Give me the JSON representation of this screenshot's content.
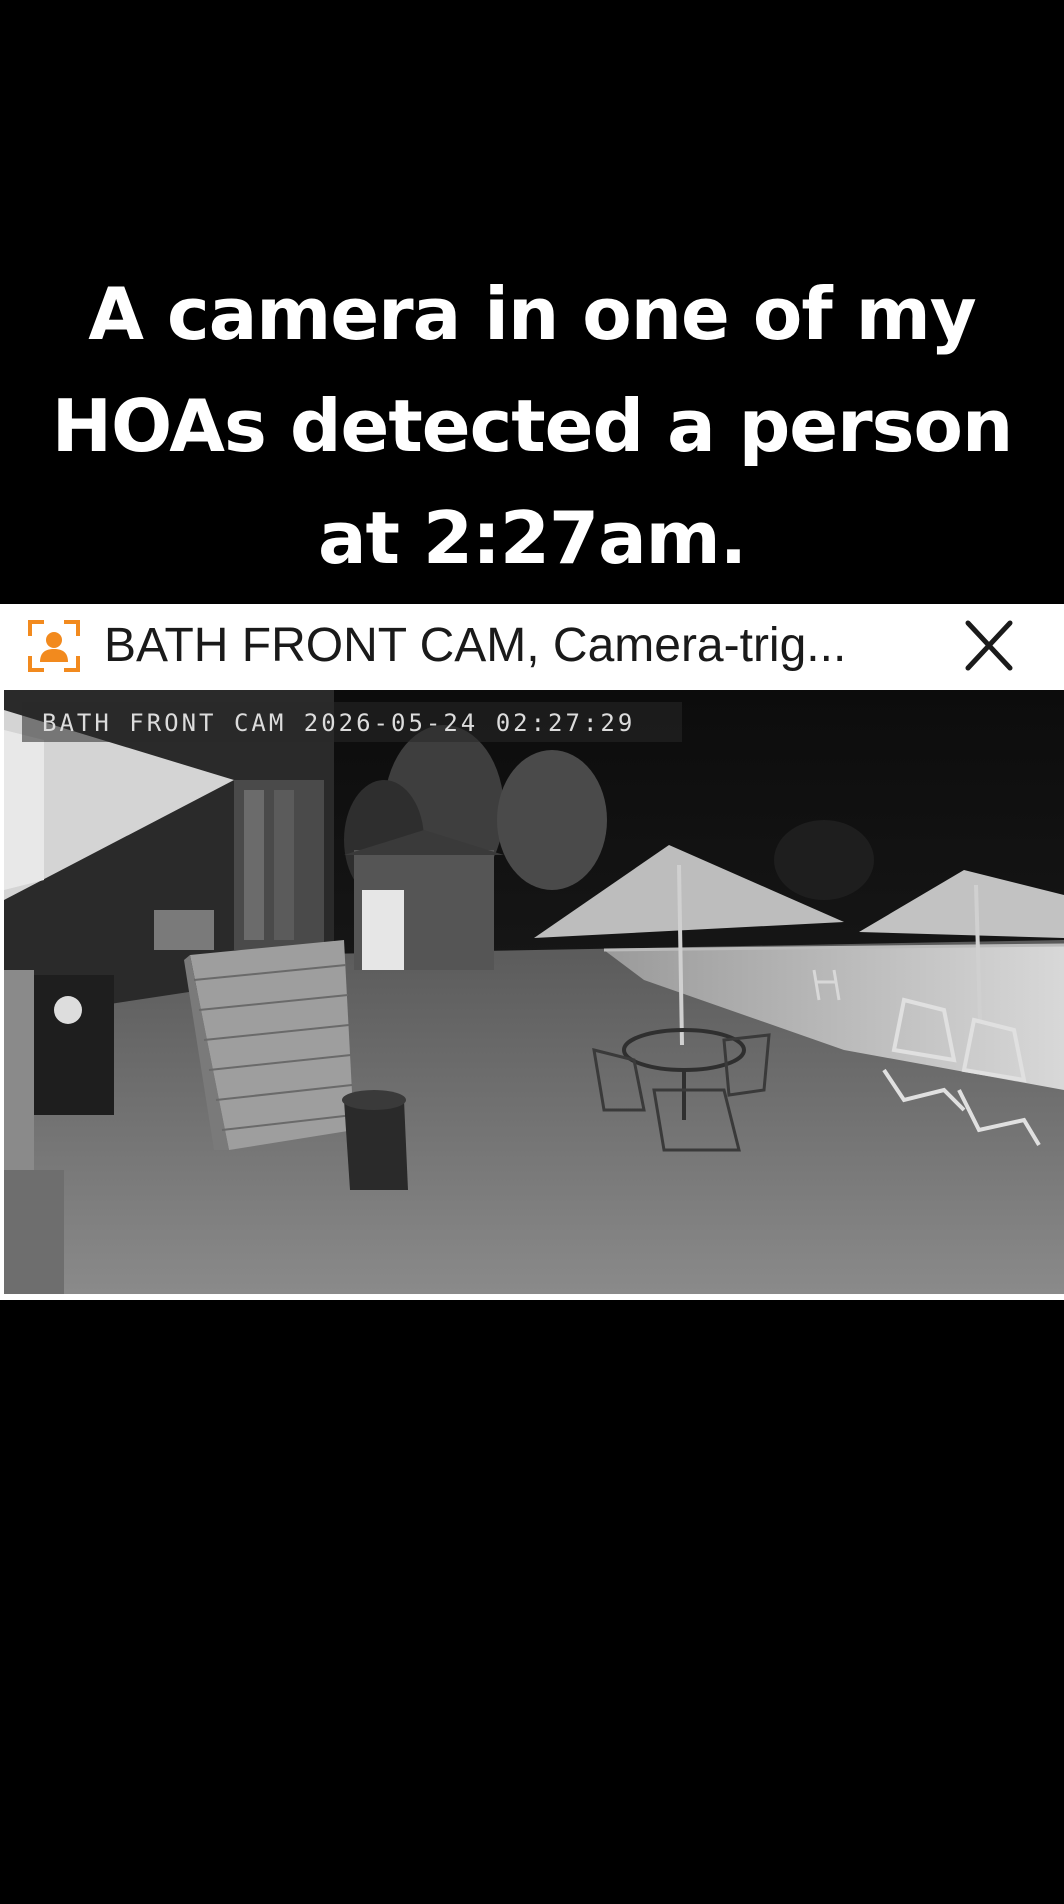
{
  "caption": {
    "line1": "A camera in one of my",
    "line2": "HOAs detected a person",
    "line3": "at 2:27am."
  },
  "notification": {
    "icon": "person-detect-icon",
    "title": "BATH FRONT CAM, Camera-trig...",
    "close_icon": "close-icon",
    "accent_color": "#f28a1e"
  },
  "camera_feed": {
    "osd_camera": "BATH FRONT CAM",
    "osd_datetime": "2026-05-24 02:27:29"
  }
}
